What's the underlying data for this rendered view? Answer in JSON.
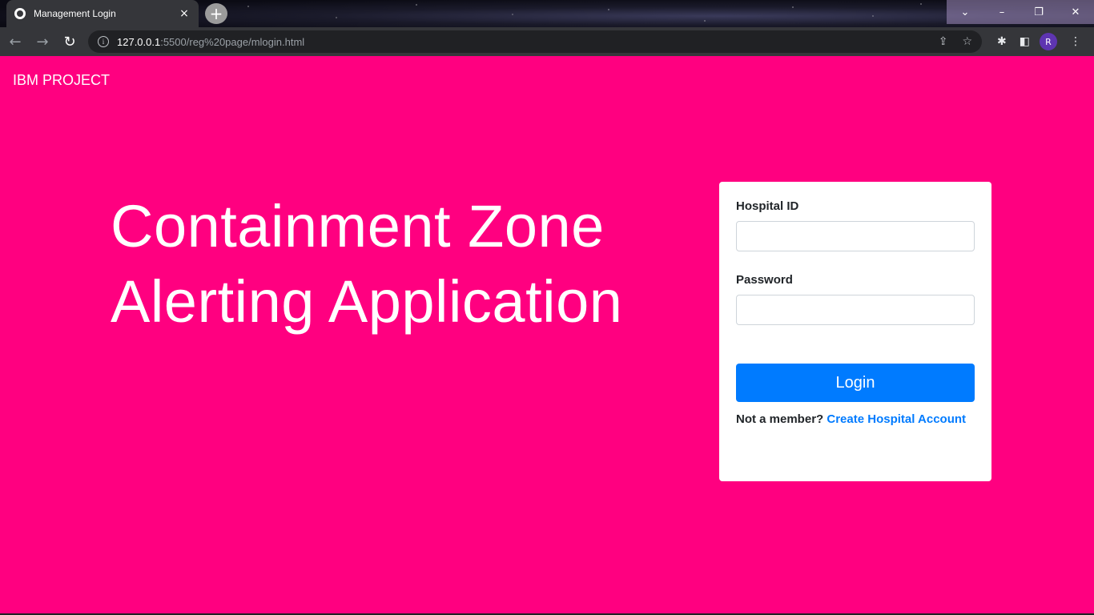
{
  "browser": {
    "tab_title": "Management Login",
    "tab_close": "×",
    "new_tab": "+",
    "url_host": "127.0.0.1",
    "url_path": ":5500/reg%20page/mlogin.html",
    "avatar_letter": "R",
    "window_controls": {
      "dropdown": "⌄",
      "minimize": "–",
      "restore": "❐",
      "close": "✕"
    },
    "icons": {
      "back": "←",
      "forward": "→",
      "reload": "↻",
      "info": "i",
      "share": "⇪",
      "star": "☆",
      "extensions": "✱",
      "sidebar": "◧",
      "menu": "⋮"
    }
  },
  "page": {
    "brand": "IBM PROJECT",
    "hero_line1": "Containment Zone",
    "hero_line2": "Alerting Application",
    "form": {
      "hospital_id_label": "Hospital ID",
      "hospital_id_value": "",
      "password_label": "Password",
      "password_value": "",
      "login_label": "Login",
      "not_member": "Not a member?",
      "create_link": "Create Hospital Account"
    }
  },
  "colors": {
    "background": "#ff0080",
    "primary": "#007bff",
    "card": "#ffffff"
  }
}
